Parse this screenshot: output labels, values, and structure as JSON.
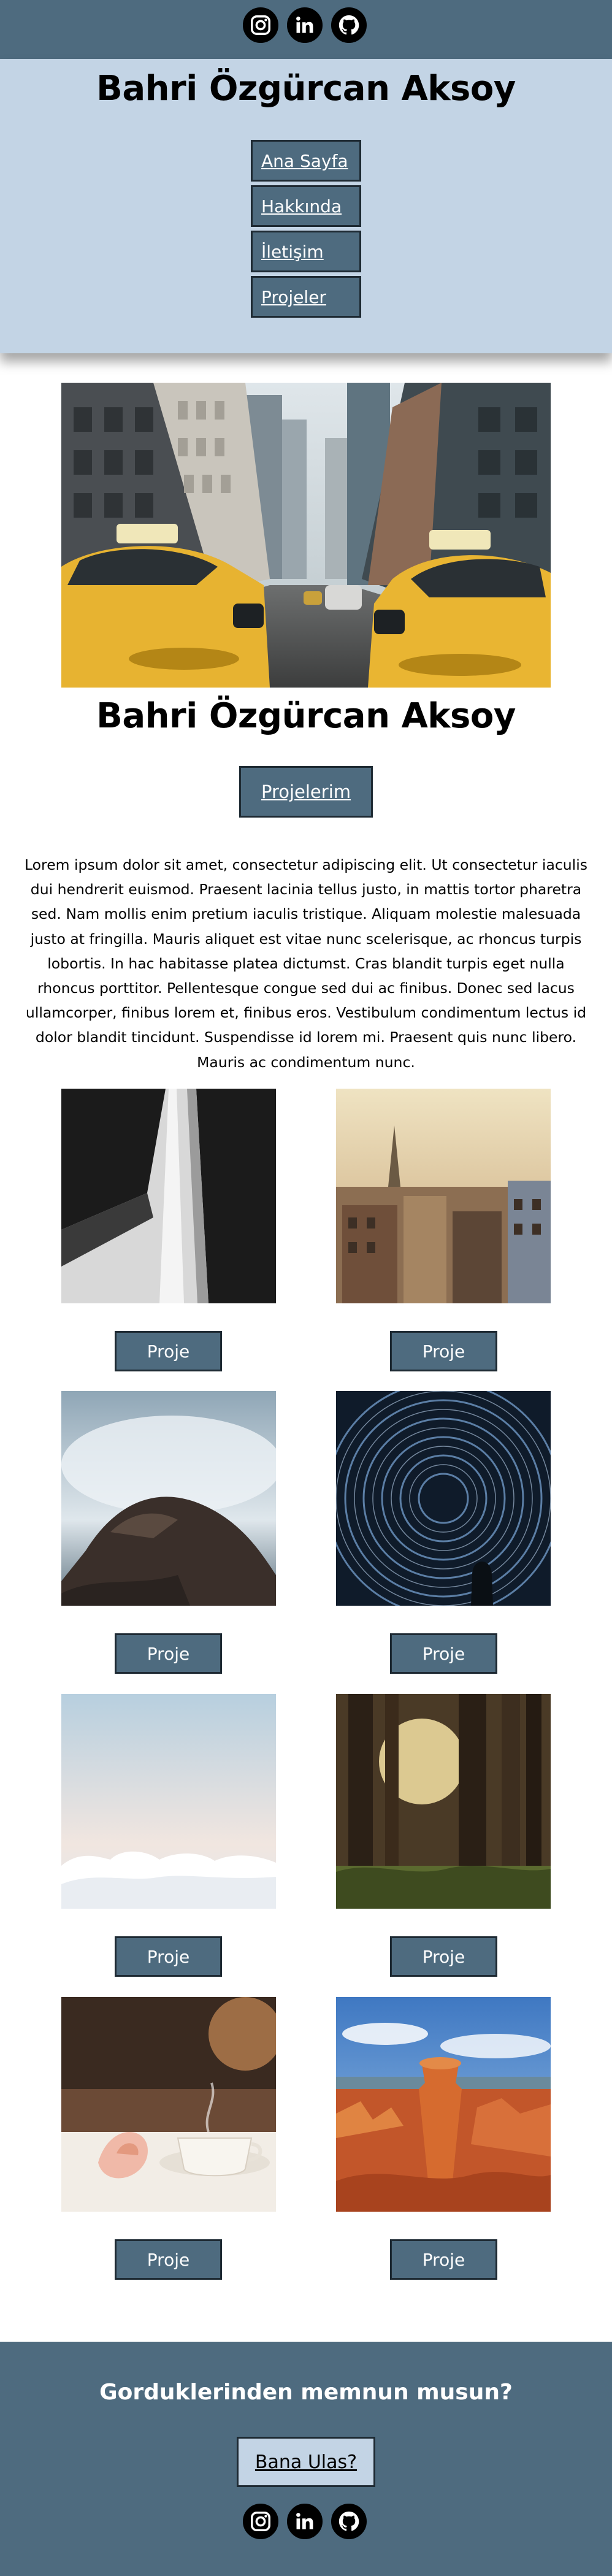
{
  "social": [
    {
      "icon": "instagram-icon"
    },
    {
      "icon": "linkedin-icon"
    },
    {
      "icon": "github-icon"
    }
  ],
  "header": {
    "title": "Bahri Özgürcan Aksoy",
    "nav": [
      {
        "label": "Ana Sayfa"
      },
      {
        "label": "Hakkında"
      },
      {
        "label": "İletişim"
      },
      {
        "label": "Projeler"
      }
    ]
  },
  "hero": {
    "title": "Bahri Özgürcan Aksoy",
    "button_label": "Projelerim",
    "intro": "Lorem ipsum dolor sit amet, consectetur adipiscing elit. Ut consectetur iaculis dui hendrerit euismod. Praesent lacinia tellus justo, in mattis tortor pharetra sed. Nam mollis enim pretium iaculis tristique. Aliquam molestie malesuada justo at fringilla. Mauris aliquet est vitae nunc scelerisque, ac rhoncus turpis lobortis. In hac habitasse platea dictumst. Cras blandit turpis eget nulla rhoncus porttitor. Pellentesque congue sed dui ac finibus. Donec sed lacus ullamcorper, finibus lorem et, finibus eros. Vestibulum condimentum lectus id dolor blandit tincidunt. Suspendisse id lorem mi. Praesent quis nunc libero. Mauris ac condimentum nunc."
  },
  "projects": [
    {
      "button_label": "Proje"
    },
    {
      "button_label": "Proje"
    },
    {
      "button_label": "Proje"
    },
    {
      "button_label": "Proje"
    },
    {
      "button_label": "Proje"
    },
    {
      "button_label": "Proje"
    },
    {
      "button_label": "Proje"
    },
    {
      "button_label": "Proje"
    }
  ],
  "footer": {
    "question": "Gorduklerinden memnun musun?",
    "button_label": "Bana Ulas?"
  },
  "colors": {
    "primary": "#4e6b7f",
    "header_bg": "#c3d4e5",
    "border": "#1e2a33",
    "text": "#000000"
  }
}
